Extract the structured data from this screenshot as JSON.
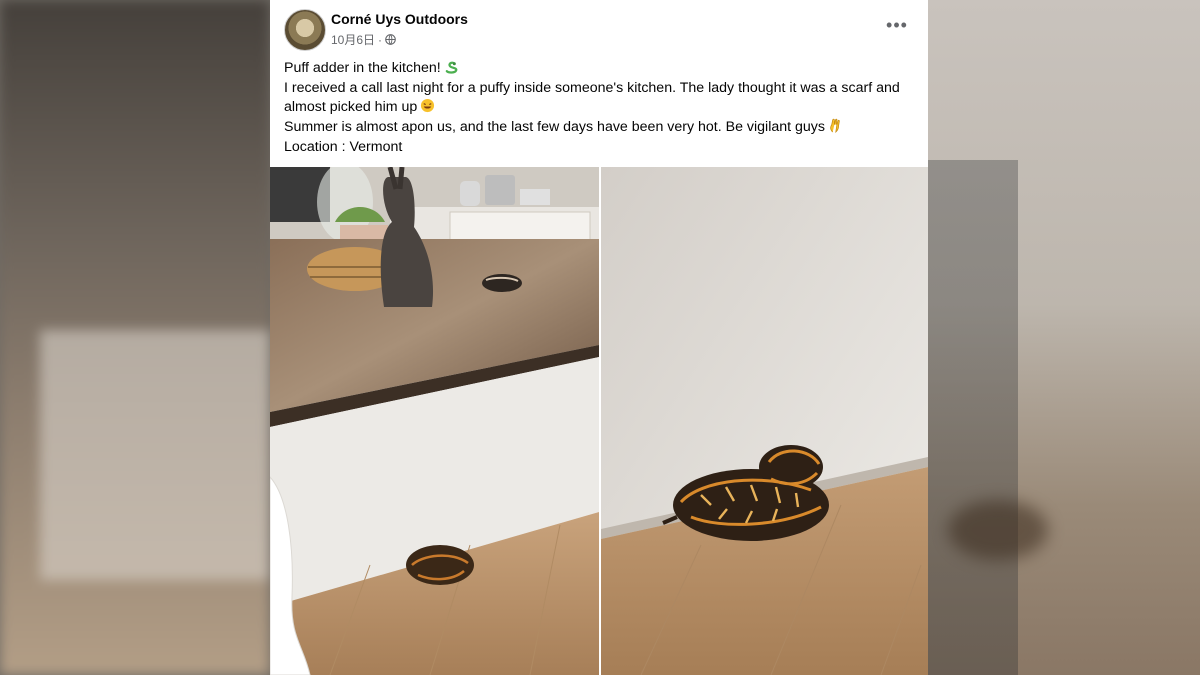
{
  "post": {
    "author": "Corné Uys Outdoors",
    "date": "10月6日",
    "separator": "·",
    "more_label": "•••",
    "lines": [
      "Puff adder in the kitchen!",
      "I received a call last night for a puffy inside someone's kitchen. The lady thought it was a scarf and almost picked him up",
      "Summer is almost apon us, and the last few days have been very hot. Be vigilant guys",
      "Location : Vermont"
    ],
    "icons": {
      "avatar": "avatar-photo",
      "audience": "globe-icon",
      "more": "more-options-icon",
      "emoji_1": "snake-emoji-icon",
      "emoji_2": "rofl-emoji-icon",
      "emoji_3": "ok-hand-emoji-icon"
    }
  },
  "photos": [
    {
      "subject": "kitchen-island-with-snake"
    },
    {
      "subject": "coiled-puff-adder-closeup"
    }
  ]
}
